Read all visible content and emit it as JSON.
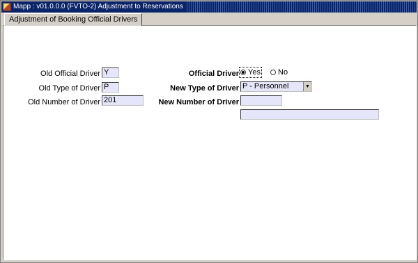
{
  "window": {
    "title": "Mapp : v01.0.0.0 (FVTO-2) Adjustment to Reservations"
  },
  "tabs": [
    {
      "label": "Adjustment of Booking Official Drivers"
    }
  ],
  "form": {
    "old_official_driver_label": "Old Official Driver",
    "old_official_driver_value": "Y",
    "old_type_label": "Old Type of Driver",
    "old_type_value": "P",
    "old_number_label": "Old Number of Driver",
    "old_number_value": "201",
    "official_driver_label": "Official Driver",
    "official_driver_options": [
      "Yes",
      "No"
    ],
    "official_driver_selected": "Yes",
    "new_type_label": "New Type of Driver",
    "new_type_value": "P - Personnel",
    "new_number_label": "New Number of Driver",
    "new_number_value": "",
    "driver_name_value": ""
  },
  "icons": {
    "app": "app-icon",
    "dropdown": "chevron-down-icon"
  }
}
